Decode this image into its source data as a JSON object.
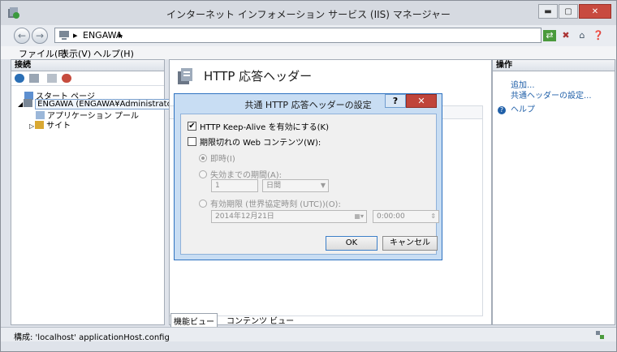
{
  "window": {
    "title": "インターネット インフォメーション サービス (IIS) マネージャー",
    "buttons": {
      "minimize": "▬",
      "maximize": "▢",
      "close": "✕"
    }
  },
  "nav": {
    "back": "←",
    "forward": "→",
    "breadcrumb": [
      "ENGAWA"
    ],
    "sep": "▸"
  },
  "menu": [
    "ファイル(F)",
    "表示(V)",
    "ヘルプ(H)"
  ],
  "connections": {
    "header": "接続",
    "tree": [
      {
        "label": "スタート ページ",
        "icon": "start-page-icon"
      },
      {
        "label": "ENGAWA (ENGAWA¥Administrator)",
        "icon": "server-icon",
        "expanded": true
      },
      {
        "label": "アプリケーション プール",
        "icon": "app-pool-icon"
      },
      {
        "label": "サイト",
        "icon": "sites-icon"
      }
    ],
    "expand_open": "◢",
    "expand_closed": "▷"
  },
  "main": {
    "title": "HTTP 応答ヘッダー",
    "view_tabs": [
      "機能ビュー",
      "コンテンツ ビュー"
    ]
  },
  "actions": {
    "header": "操作",
    "items": [
      "追加...",
      "共通ヘッダーの設定...",
      "ヘルプ"
    ]
  },
  "status": {
    "text": "構成: 'localhost' applicationHost.config"
  },
  "dialog": {
    "title": "共通 HTTP 応答ヘッダーの設定",
    "help": "?",
    "close": "✕",
    "keepalive_label": "HTTP Keep-Alive を有効にする(K)",
    "keepalive_checked": true,
    "expire_label": "期限切れの Web コンテンツ(W):",
    "expire_checked": false,
    "radio_immediate": "即時(I)",
    "radio_after": "失効までの期間(A):",
    "after_value": "1",
    "after_unit": "日間",
    "radio_on": "有効期限 (世界協定時刻 (UTC))(O):",
    "date_value": "2014年12月21日",
    "time_value": "0:00:00",
    "ok": "OK",
    "cancel": "キャンセル"
  },
  "colors": {
    "accent": "#2f73c1",
    "close": "#c0443a",
    "link": "#1f5fa8"
  }
}
